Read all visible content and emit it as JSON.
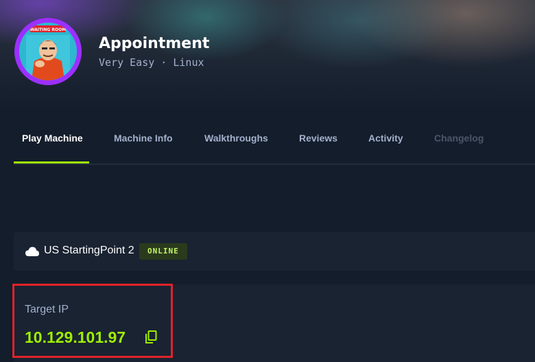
{
  "machine": {
    "name": "Appointment",
    "subtitle": "Very Easy · Linux",
    "avatar_label": "WAITING ROOM"
  },
  "tabs": [
    {
      "label": "Play Machine",
      "state": "active"
    },
    {
      "label": "Machine Info",
      "state": "normal"
    },
    {
      "label": "Walkthroughs",
      "state": "normal"
    },
    {
      "label": "Reviews",
      "state": "normal"
    },
    {
      "label": "Activity",
      "state": "normal"
    },
    {
      "label": "Changelog",
      "state": "disabled"
    }
  ],
  "server": {
    "icon": "cloud-icon",
    "name": "US StartingPoint 2",
    "status": "ONLINE"
  },
  "target": {
    "label": "Target IP",
    "ip": "10.129.101.97",
    "copy_icon": "copy-icon"
  },
  "colors": {
    "accent": "#9fef00",
    "background": "#141d2b",
    "panel": "#1a2332",
    "highlight": "#e0232a",
    "avatar_ring": "#9b30ff"
  }
}
